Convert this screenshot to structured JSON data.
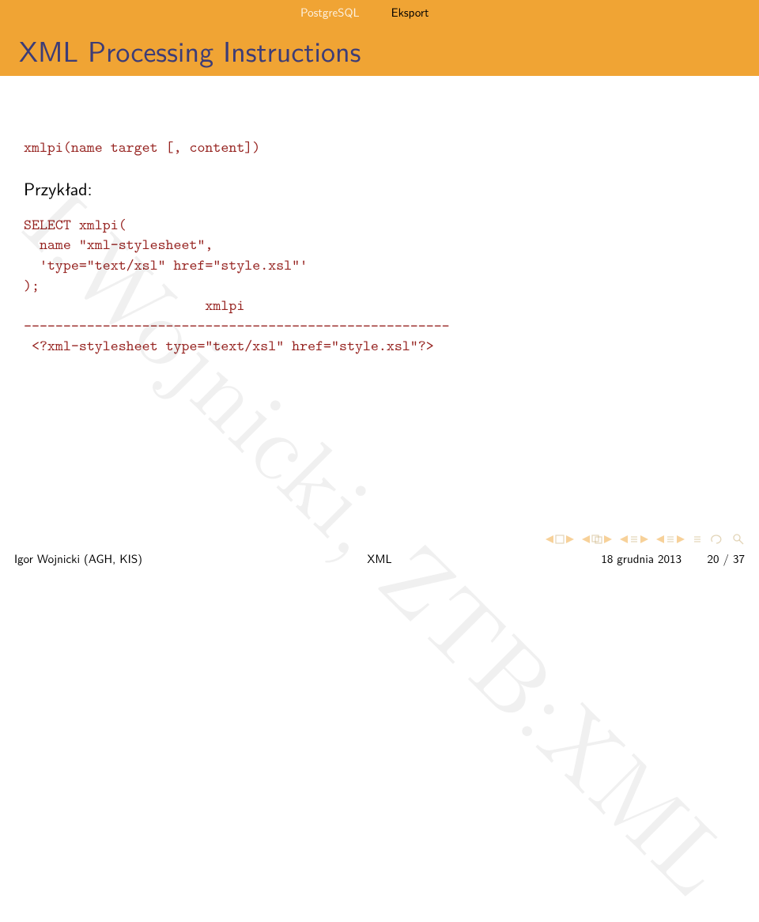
{
  "topbar": {
    "tab1": "PostgreSQL",
    "tab2": "Eksport"
  },
  "title": "XML Processing Instructions",
  "watermark": "I.Wojnicki, ZTB:XML",
  "body": {
    "sig": "xmlpi(name target [, content])",
    "example_label": "Przykład:",
    "code": "SELECT xmlpi(\n  name \"xml-stylesheet\",\n  'type=\"text/xsl\" href=\"style.xsl\"'\n);\n                       xmlpi\n------------------------------------------------------\n <?xml-stylesheet type=\"text/xsl\" href=\"style.xsl\"?>"
  },
  "footer": {
    "left": "Igor Wojnicki (AGH, KIS)",
    "center": "XML",
    "right": "18 grudnia 2013",
    "page": "20 / 37"
  }
}
